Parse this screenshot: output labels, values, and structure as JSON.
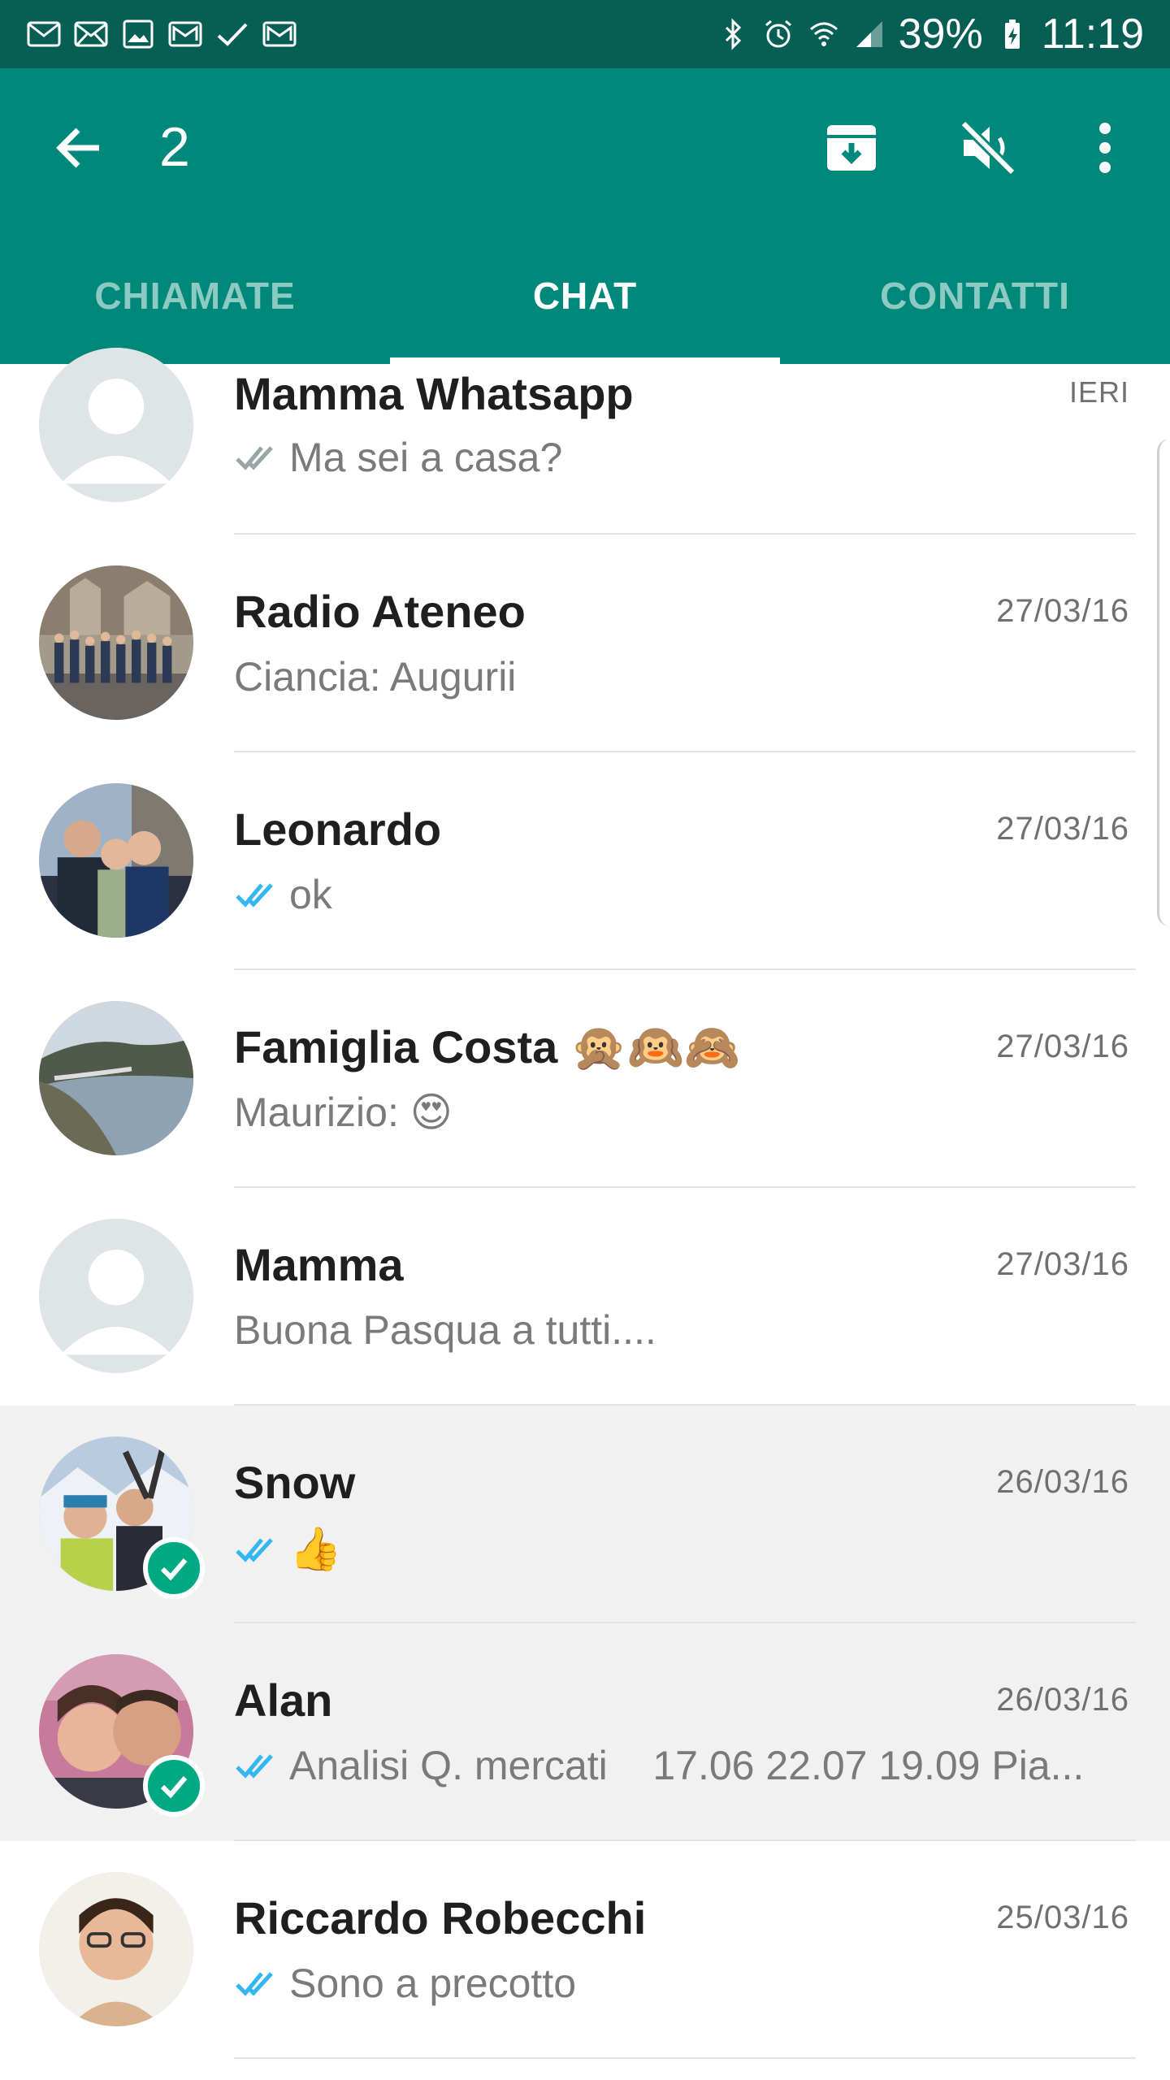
{
  "status_bar": {
    "battery_percent": "39%",
    "time": "11:19",
    "left_icons": [
      "mail-icon",
      "mail-icon",
      "image-icon",
      "mail-icon",
      "check-icon",
      "mail-icon"
    ],
    "right_icons": [
      "bluetooth-icon",
      "alarm-icon",
      "wifi-icon",
      "signal-icon",
      "battery-charging-icon"
    ]
  },
  "toolbar": {
    "selected_count": "2",
    "actions": [
      "archive-icon",
      "mute-icon",
      "more-icon"
    ]
  },
  "tabs": [
    {
      "label": "CHIAMATE",
      "active": false
    },
    {
      "label": "CHAT",
      "active": true
    },
    {
      "label": "CONTATTI",
      "active": false
    }
  ],
  "chats": [
    {
      "name": "Mamma Whatsapp",
      "date": "IERI",
      "preview": "Ma sei a casa?",
      "ticks": "read-gray",
      "selected": false,
      "avatar": "default"
    },
    {
      "name": "Radio Ateneo",
      "date": "27/03/16",
      "preview": "Ciancia: Augurii",
      "ticks": "none",
      "selected": false,
      "avatar": "photo-group"
    },
    {
      "name": "Leonardo",
      "date": "27/03/16",
      "preview": "ok",
      "ticks": "read-blue",
      "selected": false,
      "avatar": "photo-family"
    },
    {
      "name": "Famiglia Costa",
      "name_emoji": "🙊🙉🙈",
      "date": "27/03/16",
      "preview": "Maurizio: 😍",
      "ticks": "none",
      "selected": false,
      "avatar": "photo-coast"
    },
    {
      "name": "Mamma",
      "date": "27/03/16",
      "preview": "Buona Pasqua a tutti....",
      "ticks": "none",
      "selected": false,
      "avatar": "default"
    },
    {
      "name": "Snow",
      "date": "26/03/16",
      "preview": "👍",
      "ticks": "read-blue",
      "selected": true,
      "avatar": "photo-snow"
    },
    {
      "name": "Alan",
      "date": "26/03/16",
      "preview": "Analisi Q. mercati    17.06 22.07 19.09 Pia...",
      "ticks": "read-blue",
      "selected": true,
      "avatar": "photo-couple"
    },
    {
      "name": "Riccardo Robecchi",
      "date": "25/03/16",
      "preview": "Sono a precotto",
      "ticks": "read-blue",
      "selected": false,
      "avatar": "photo-portrait"
    }
  ],
  "colors": {
    "status_bar": "#075e54",
    "app_bar": "#00897b",
    "selected_row": "#f1f1f1",
    "read_ticks": "#34b7f1",
    "badge": "#00a884"
  }
}
